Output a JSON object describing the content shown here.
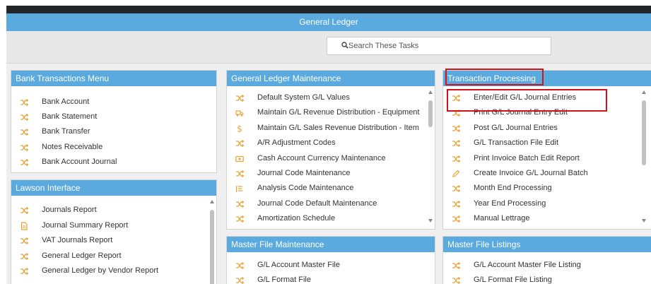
{
  "header": {
    "title": "General Ledger"
  },
  "search": {
    "placeholder": "Search These Tasks"
  },
  "colors": {
    "accent": "#5aaadf",
    "icon_orange": "#e8a33a",
    "highlight": "#d0121b"
  },
  "panels": {
    "bank": {
      "title": "Bank Transactions Menu",
      "items": [
        {
          "label": "Bank Account",
          "icon": "shuffle-icon"
        },
        {
          "label": "Bank Statement",
          "icon": "shuffle-icon"
        },
        {
          "label": "Bank Transfer",
          "icon": "shuffle-icon"
        },
        {
          "label": "Notes Receivable",
          "icon": "shuffle-icon"
        },
        {
          "label": "Bank Account Journal",
          "icon": "shuffle-icon"
        }
      ]
    },
    "lawson": {
      "title": "Lawson Interface",
      "items": [
        {
          "label": "Journals Report",
          "icon": "shuffle-icon"
        },
        {
          "label": "Journal Summary Report",
          "icon": "document-icon"
        },
        {
          "label": "VAT Journals Report",
          "icon": "shuffle-icon"
        },
        {
          "label": "General Ledger Report",
          "icon": "shuffle-icon"
        },
        {
          "label": "General Ledger by Vendor Report",
          "icon": "shuffle-icon"
        }
      ]
    },
    "glmaint": {
      "title": "General Ledger Maintenance",
      "items": [
        {
          "label": "Default System G/L Values",
          "icon": "shuffle-icon"
        },
        {
          "label": "Maintain G/L Revenue Distribution - Equipment",
          "icon": "truck-icon"
        },
        {
          "label": "Maintain G/L Sales Revenue Distribution - Item",
          "icon": "dollar-icon"
        },
        {
          "label": "A/R Adjustment Codes",
          "icon": "shuffle-icon"
        },
        {
          "label": "Cash Account Currency Maintenance",
          "icon": "money-icon"
        },
        {
          "label": "Journal Code Maintenance",
          "icon": "shuffle-icon"
        },
        {
          "label": "Analysis Code Maintenance",
          "icon": "list-icon"
        },
        {
          "label": "Journal Code Default Maintenance",
          "icon": "shuffle-icon"
        },
        {
          "label": "Amortization Schedule",
          "icon": "shuffle-icon"
        }
      ]
    },
    "txn": {
      "title": "Transaction Processing",
      "items": [
        {
          "label": "Enter/Edit G/L Journal Entries",
          "icon": "shuffle-icon"
        },
        {
          "label": "Print G/L Journal Entry Edit",
          "icon": "shuffle-icon"
        },
        {
          "label": "Post G/L Journal Entries",
          "icon": "shuffle-icon"
        },
        {
          "label": "G/L Transaction File Edit",
          "icon": "shuffle-icon"
        },
        {
          "label": "Print Invoice Batch Edit Report",
          "icon": "shuffle-icon"
        },
        {
          "label": "Create Invoice G/L Journal Batch",
          "icon": "pencil-icon"
        },
        {
          "label": "Month End Processing",
          "icon": "shuffle-icon"
        },
        {
          "label": "Year End Processing",
          "icon": "shuffle-icon"
        },
        {
          "label": "Manual Lettrage",
          "icon": "shuffle-icon"
        }
      ]
    },
    "masterfile": {
      "title": "Master File Maintenance",
      "items": [
        {
          "label": "G/L Account Master File",
          "icon": "shuffle-icon"
        },
        {
          "label": "G/L Format File",
          "icon": "shuffle-icon"
        }
      ]
    },
    "listings": {
      "title": "Master File Listings",
      "items": [
        {
          "label": "G/L Account Master File Listing",
          "icon": "shuffle-icon"
        },
        {
          "label": "G/L Format File Listing",
          "icon": "shuffle-icon"
        }
      ]
    }
  }
}
